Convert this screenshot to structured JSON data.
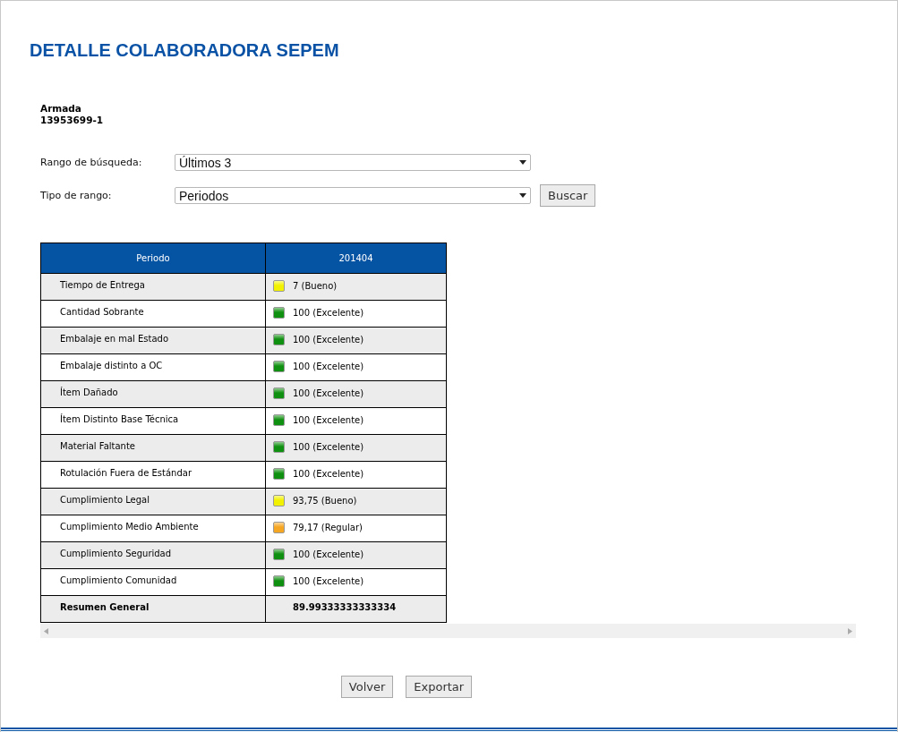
{
  "title": "DETALLE COLABORADORA SEPEM",
  "supplier": {
    "name": "Armada",
    "rut": "13953699-1"
  },
  "filters": [
    {
      "label": "Rango de búsqueda:",
      "value": "Últimos 3"
    },
    {
      "label": "Tipo de rango:",
      "value": "Periodos"
    }
  ],
  "search_button": "Buscar",
  "table": {
    "columns": [
      "Periodo",
      "201404"
    ],
    "rows": [
      {
        "label": "Tiempo de Entrega",
        "value": "7 (Bueno)",
        "color": "#f2f200"
      },
      {
        "label": "Cantidad Sobrante",
        "value": "100 (Excelente)",
        "color": "#109010"
      },
      {
        "label": "Embalaje en mal Estado",
        "value": "100 (Excelente)",
        "color": "#109010"
      },
      {
        "label": "Embalaje distinto a OC",
        "value": "100 (Excelente)",
        "color": "#109010"
      },
      {
        "label": "Ítem Dañado",
        "value": "100 (Excelente)",
        "color": "#109010"
      },
      {
        "label": "Ítem Distinto Base Técnica",
        "value": "100 (Excelente)",
        "color": "#109010"
      },
      {
        "label": "Material Faltante",
        "value": "100 (Excelente)",
        "color": "#109010"
      },
      {
        "label": "Rotulación Fuera de Estándar",
        "value": "100 (Excelente)",
        "color": "#109010"
      },
      {
        "label": "Cumplimiento Legal",
        "value": "93,75 (Bueno)",
        "color": "#f2f200"
      },
      {
        "label": "Cumplimiento Medio Ambiente",
        "value": "79,17 (Regular)",
        "color": "#f5a623"
      },
      {
        "label": "Cumplimiento Seguridad",
        "value": "100 (Excelente)",
        "color": "#109010"
      },
      {
        "label": "Cumplimiento Comunidad",
        "value": "100 (Excelente)",
        "color": "#109010"
      }
    ],
    "summary": {
      "label": "Resumen General",
      "value": "89.99333333333334"
    }
  },
  "buttons": [
    "Volver",
    "Exportar"
  ]
}
